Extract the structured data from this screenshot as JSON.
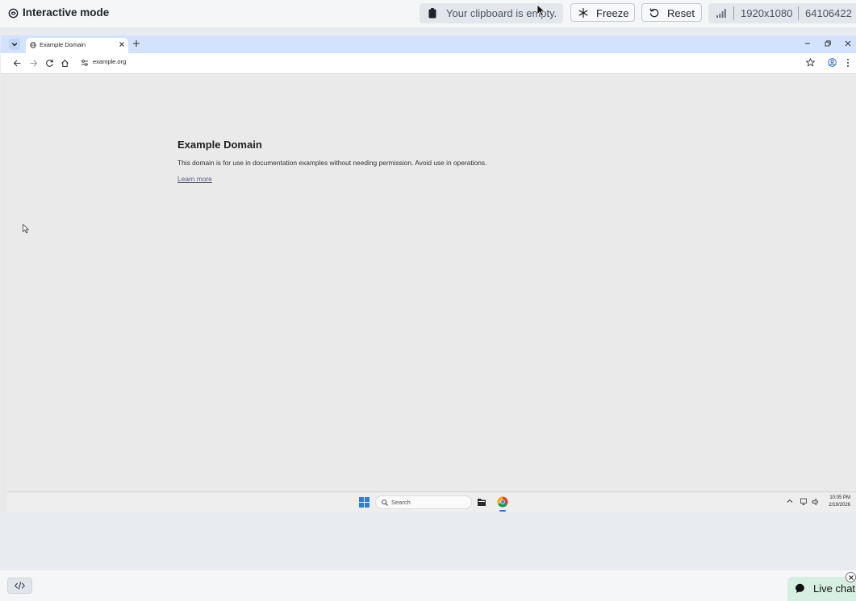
{
  "topbar": {
    "mode_title": "Interactive mode",
    "clipboard_text": "Your clipboard is empty.",
    "freeze_label": "Freeze",
    "reset_label": "Reset",
    "resolution": "1920x1080",
    "session_id": "64106422"
  },
  "browser": {
    "tab_title": "Example Domain",
    "url": "example.org"
  },
  "page": {
    "heading": "Example Domain",
    "paragraph": "This domain is for use in documentation examples without needing permission. Avoid use in operations.",
    "link_text": "Learn more"
  },
  "taskbar": {
    "search_placeholder": "Search",
    "time": "10:05 PM",
    "date": "2/19/2026"
  },
  "bottombar": {
    "chat_label": "Live chat"
  },
  "colors": {
    "tabstrip": "#d3e3fd",
    "live_chat_bg": "#d7efe2",
    "chrome_taskbar_indicator": "#2b6fd1"
  }
}
